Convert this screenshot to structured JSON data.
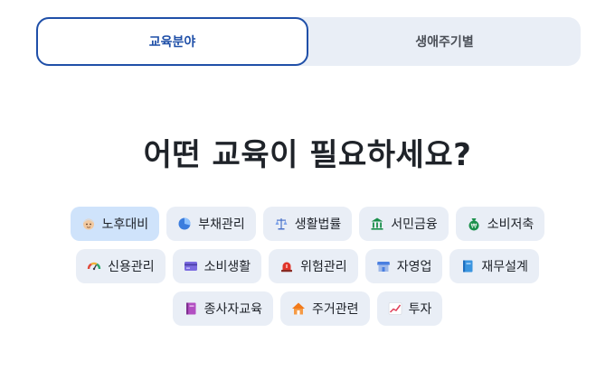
{
  "tabs": {
    "active_label": "교육분야",
    "inactive_label": "생애주기별"
  },
  "headline": "어떤 교육이 필요하세요?",
  "chips": {
    "retirement": {
      "label": "노후대비",
      "icon": "elderly-face-icon"
    },
    "debt": {
      "label": "부채관리",
      "icon": "pie-chart-icon"
    },
    "law": {
      "label": "생활법률",
      "icon": "scales-icon"
    },
    "finance": {
      "label": "서민금융",
      "icon": "bank-building-icon"
    },
    "saving": {
      "label": "소비저축",
      "icon": "money-bag-icon"
    },
    "credit": {
      "label": "신용관리",
      "icon": "gauge-icon"
    },
    "consumer": {
      "label": "소비생활",
      "icon": "credit-card-icon"
    },
    "risk": {
      "label": "위험관리",
      "icon": "siren-icon"
    },
    "self_employed": {
      "label": "자영업",
      "icon": "store-icon"
    },
    "planning": {
      "label": "재무설계",
      "icon": "book-icon"
    },
    "workers": {
      "label": "종사자교육",
      "icon": "notebook-icon"
    },
    "housing": {
      "label": "주거관련",
      "icon": "house-icon"
    },
    "invest": {
      "label": "투자",
      "icon": "rising-chart-icon"
    }
  },
  "colors": {
    "accent": "#1f4fa8",
    "chip_bg": "#e9eef6",
    "chip_selected_bg": "#cfe3fb"
  }
}
